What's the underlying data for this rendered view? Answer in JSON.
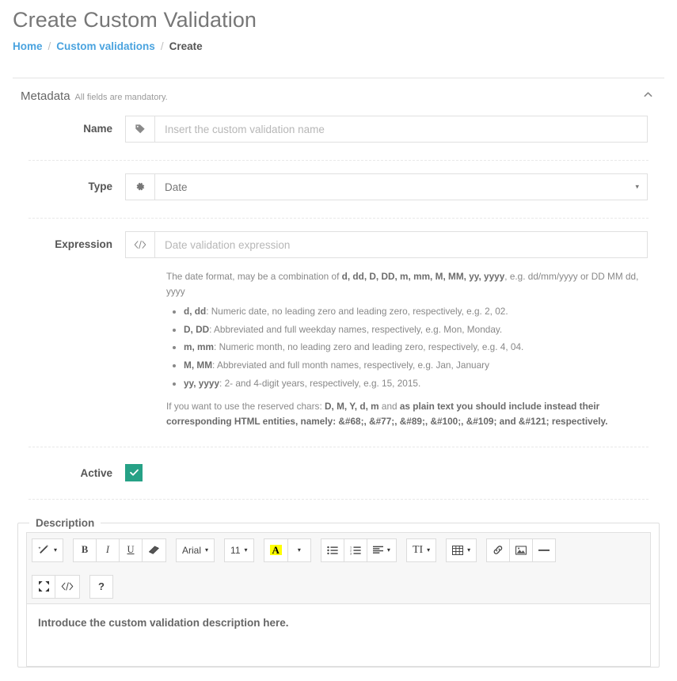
{
  "header": {
    "title": "Create Custom Validation",
    "breadcrumb": [
      {
        "label": "Home",
        "type": "link"
      },
      {
        "label": "/",
        "type": "sep"
      },
      {
        "label": "Custom validations",
        "type": "link"
      },
      {
        "label": "/",
        "type": "sep"
      },
      {
        "label": "Create",
        "type": "current"
      }
    ]
  },
  "metadata": {
    "title": "Metadata",
    "subtitle": "All fields are mandatory.",
    "collapse_icon": "chevron-up-icon",
    "fields": {
      "name": {
        "label": "Name",
        "icon": "tag-icon",
        "value": "",
        "placeholder": "Insert the custom validation name"
      },
      "type": {
        "label": "Type",
        "icon": "gear-icon",
        "value": "Date",
        "caret": "▾",
        "options": [
          "Date"
        ]
      },
      "expression": {
        "label": "Expression",
        "icon": "code-icon",
        "value": "",
        "placeholder": "Date validation expression"
      },
      "active": {
        "label": "Active",
        "checked": true,
        "check_color": "#26a186"
      }
    },
    "help": {
      "intro_prefix": "The date format, may be a combination of ",
      "intro_tokens": "d, dd, D, DD, m, mm, M, MM, yy, yyyy",
      "intro_suffix": ", e.g. dd/mm/yyyy or DD MM dd, yyyy",
      "items": [
        {
          "tokens": "d, dd",
          "text": ": Numeric date, no leading zero and leading zero, respectively, e.g. 2, 02."
        },
        {
          "tokens": "D, DD",
          "text": ": Abbreviated and full weekday names, respectively, e.g. Mon, Monday."
        },
        {
          "tokens": "m, mm",
          "text": ": Numeric month, no leading zero and leading zero, respectively, e.g. 4, 04."
        },
        {
          "tokens": "M, MM",
          "text": ": Abbreviated and full month names, respectively, e.g. Jan, January"
        },
        {
          "tokens": "yy, yyyy",
          "text": ": 2- and 4-digit years, respectively, e.g. 15, 2015."
        }
      ],
      "note_prefix": "If you want to use the reserved chars: ",
      "note_chars": "D, M, Y, d, m",
      "note_mid": " and ",
      "note_bold": "as plain text you should include instead their corresponding HTML entities, namely: &#68;, &#77;, &#89;, &#100;, &#109; and &#121; respectively."
    }
  },
  "description": {
    "legend": "Description",
    "body_text": "Introduce the custom validation description here.",
    "toolbar": {
      "row1": [
        {
          "group": [
            {
              "name": "magic-wand-icon",
              "kind": "icon",
              "caret": true
            }
          ]
        },
        {
          "group": [
            {
              "name": "bold-icon",
              "kind": "text",
              "label": "B",
              "style": "serif-bold"
            },
            {
              "name": "italic-icon",
              "kind": "text",
              "label": "I",
              "style": "serif-italic"
            },
            {
              "name": "underline-icon",
              "kind": "text",
              "label": "U",
              "style": "serif-underline"
            },
            {
              "name": "eraser-icon",
              "kind": "icon"
            }
          ]
        },
        {
          "group": [
            {
              "name": "font-family-select",
              "kind": "text",
              "label": "Arial",
              "caret": true
            }
          ]
        },
        {
          "group": [
            {
              "name": "font-size-select",
              "kind": "text",
              "label": "11",
              "caret": true
            }
          ]
        },
        {
          "group": [
            {
              "name": "highlight-color-icon",
              "kind": "highlight",
              "label": "A"
            },
            {
              "name": "color-picker-caret-icon",
              "kind": "caret-only"
            }
          ]
        },
        {
          "group": [
            {
              "name": "unordered-list-icon",
              "kind": "icon"
            },
            {
              "name": "ordered-list-icon",
              "kind": "icon"
            },
            {
              "name": "paragraph-align-icon",
              "kind": "icon",
              "caret": true
            }
          ]
        },
        {
          "group": [
            {
              "name": "line-height-icon",
              "kind": "text",
              "label": "TI",
              "style": "serif",
              "caret": true
            }
          ]
        },
        {
          "group": [
            {
              "name": "table-icon",
              "kind": "icon",
              "caret": true
            }
          ]
        },
        {
          "group": [
            {
              "name": "link-icon",
              "kind": "icon"
            },
            {
              "name": "picture-icon",
              "kind": "icon"
            },
            {
              "name": "horizontal-rule-icon",
              "kind": "icon"
            }
          ]
        }
      ],
      "row2": [
        {
          "group": [
            {
              "name": "fullscreen-icon",
              "kind": "icon"
            },
            {
              "name": "code-view-icon",
              "kind": "icon"
            }
          ]
        },
        {
          "group": [
            {
              "name": "help-icon",
              "kind": "text",
              "label": "?",
              "style": "bold"
            }
          ]
        }
      ]
    }
  },
  "colors": {
    "link": "#4aa3db",
    "accent_green": "#26a186",
    "highlight_yellow": "#ffff00",
    "border": "#e0e0e0"
  }
}
